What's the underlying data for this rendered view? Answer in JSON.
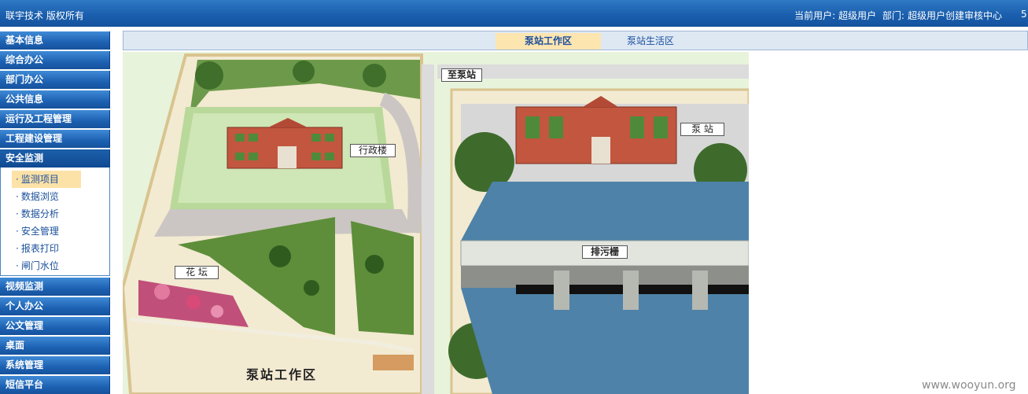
{
  "header": {
    "brand": "联宇技术 版权所有",
    "user_label": "当前用户:",
    "user_name": "超级用户",
    "dept_label": "部门:",
    "dept_name": "超级用户创建审核中心",
    "edge_text": "5"
  },
  "sidebar": {
    "items_top": [
      {
        "label": "基本信息"
      },
      {
        "label": "综合办公"
      },
      {
        "label": "部门办公"
      },
      {
        "label": "公共信息"
      },
      {
        "label": "运行及工程管理"
      },
      {
        "label": "工程建设管理"
      },
      {
        "label": "安全监测"
      }
    ],
    "submenu": [
      {
        "label": "监测项目",
        "active": true
      },
      {
        "label": "数据浏览"
      },
      {
        "label": "数据分析"
      },
      {
        "label": "安全管理"
      },
      {
        "label": "报表打印"
      },
      {
        "label": "闸门水位"
      }
    ],
    "items_bottom": [
      {
        "label": "视频监测"
      },
      {
        "label": "个人办公"
      },
      {
        "label": "公文管理"
      },
      {
        "label": "桌面"
      },
      {
        "label": "系统管理"
      },
      {
        "label": "短信平台"
      }
    ]
  },
  "tabs": {
    "tab1": "泵站工作区",
    "tab2": "泵站生活区"
  },
  "map": {
    "label_to_station": "至泵站",
    "label_admin": "行政楼",
    "label_pump": "泵 站",
    "label_garden": "花 坛",
    "label_trash_rack": "排污栅",
    "area_title": "泵站工作区"
  },
  "watermark": "www.wooyun.org",
  "colors": {
    "header_blue": "#1a5fae",
    "nav_blue": "#1d61b2",
    "tab_active": "#fde5b0",
    "submenu_active": "#fde2a8"
  }
}
